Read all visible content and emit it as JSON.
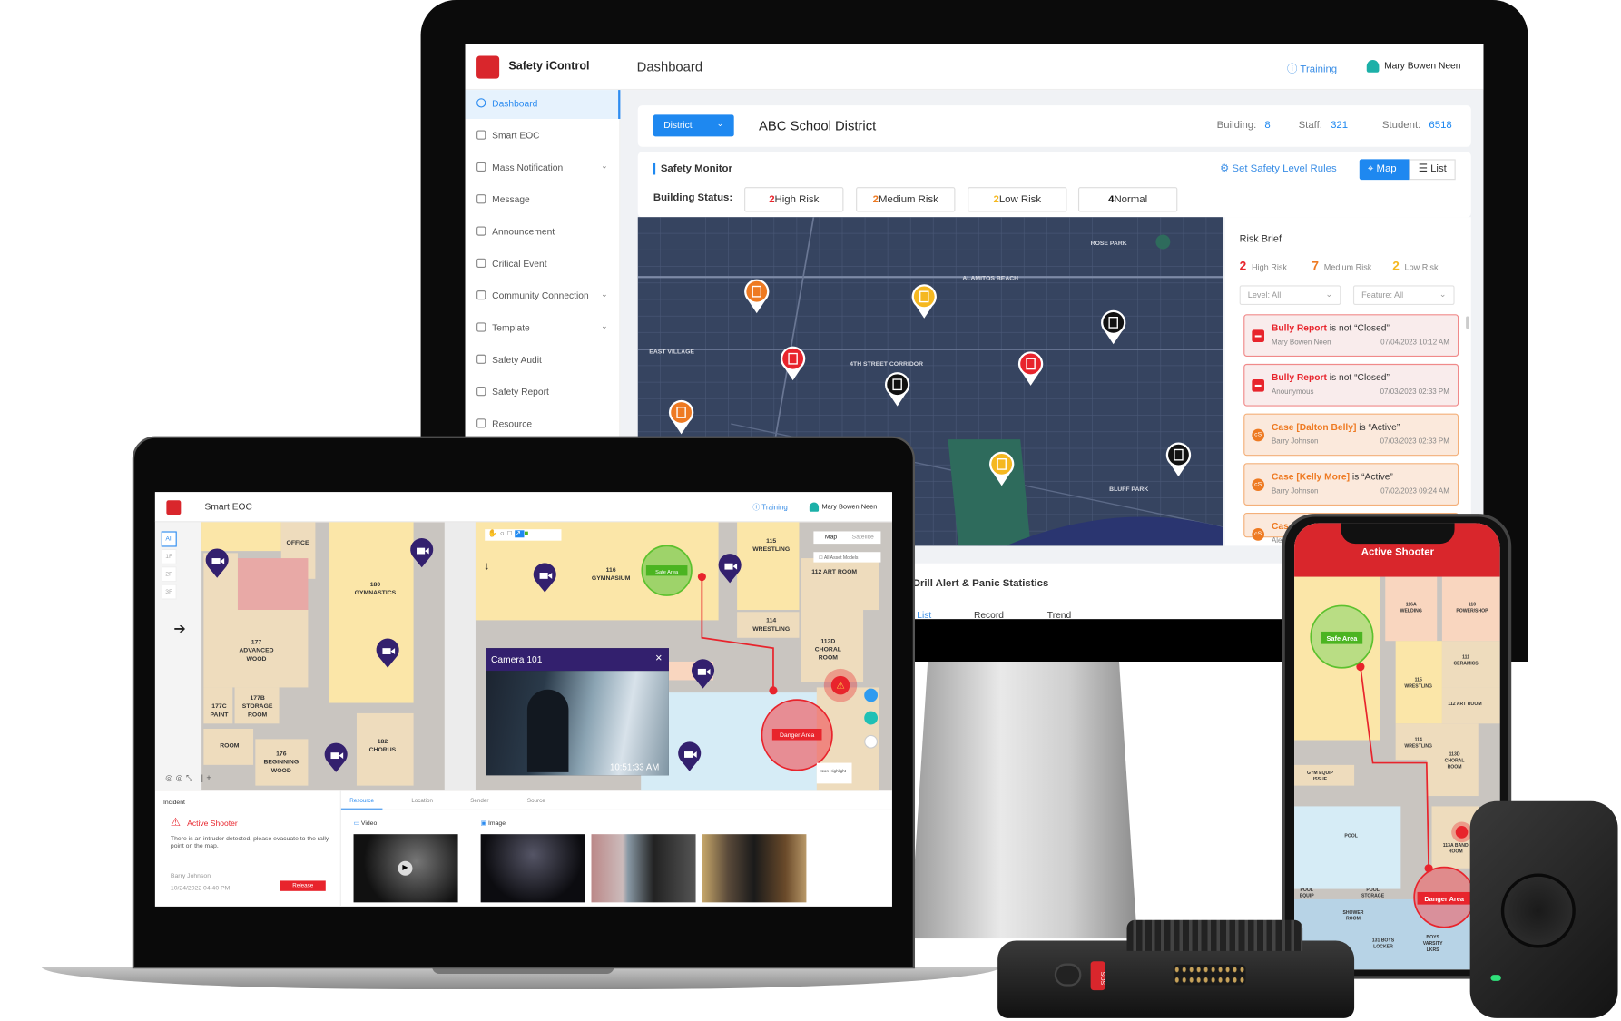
{
  "monitor": {
    "brand": "Safety iControl",
    "header_title": "Dashboard",
    "training": "Training",
    "user": "Mary Bowen Neen",
    "sidebar": [
      {
        "label": "Dashboard",
        "active": true
      },
      {
        "label": "Smart EOC"
      },
      {
        "label": "Mass Notification",
        "expandable": true
      },
      {
        "label": "Message"
      },
      {
        "label": "Announcement"
      },
      {
        "label": "Critical Event"
      },
      {
        "label": "Community Connection",
        "expandable": true
      },
      {
        "label": "Template",
        "expandable": true
      },
      {
        "label": "Safety Audit"
      },
      {
        "label": "Safety Report"
      },
      {
        "label": "Resource"
      }
    ],
    "chevron": "⌄",
    "district_select": "District",
    "district_name": "ABC School District",
    "stats": {
      "building_label": "Building:",
      "building": "8",
      "staff_label": "Staff:",
      "staff": "321",
      "student_label": "Student:",
      "student": "6518"
    },
    "safety_monitor": "Safety Monitor",
    "set_rules": "Set Safety Level Rules",
    "map_toggle": "Map",
    "list_toggle": "List",
    "building_status_label": "Building Status:",
    "status": [
      {
        "count": "2",
        "label": "High Risk",
        "color": "#e8242c"
      },
      {
        "count": "2",
        "label": "Medium Risk",
        "color": "#ee7a22"
      },
      {
        "count": "2",
        "label": "Low Risk",
        "color": "#f5b820"
      },
      {
        "count": "4",
        "label": "Normal",
        "color": "#111111"
      }
    ],
    "map": {
      "areas": [
        "ROSE PARK",
        "ALAMITOS BEACH",
        "EAST VILLAGE",
        "4TH STREET CORRIDOR",
        "BLUFF PARK"
      ],
      "pins": [
        "medium",
        "medium",
        "low",
        "low",
        "high",
        "high",
        "normal",
        "normal",
        "normal"
      ]
    },
    "risk_brief": {
      "title": "Risk Brief",
      "counts": [
        {
          "count": "2",
          "label": "High Risk",
          "color": "#e8242c"
        },
        {
          "count": "7",
          "label": "Medium Risk",
          "color": "#ee7a22"
        },
        {
          "count": "2",
          "label": "Low Risk",
          "color": "#f5b820"
        }
      ],
      "level_filter": "Level: All",
      "feature_filter": "Feature: All",
      "alerts": [
        {
          "level": "hi",
          "subject": "Bully Report",
          "status": " is not “Closed”",
          "who": "Mary Bowen Neen",
          "time": "07/04/2023 10:12 AM"
        },
        {
          "level": "hi",
          "subject": "Bully Report",
          "status": " is not “Closed”",
          "who": "Anounymous",
          "time": "07/03/2023 02:33 PM"
        },
        {
          "level": "med",
          "subject": "Case [Dalton Belly]",
          "status": " is “Active”",
          "who": "Barry Johnson",
          "time": "07/03/2023 02:33 PM"
        },
        {
          "level": "med",
          "subject": "Case [Kelly More]",
          "status": " is “Active”",
          "who": "Barry Johnson",
          "time": "07/02/2023 09:24 AM"
        },
        {
          "level": "med",
          "subject": "Cas",
          "status": "",
          "who": "Ale",
          "time": ""
        }
      ]
    },
    "drill": {
      "title": "Drill Alert & Panic Statistics",
      "tabs": [
        "List",
        "Record",
        "Trend"
      ]
    }
  },
  "laptop": {
    "app_title": "Smart EOC",
    "training": "Training",
    "user": "Mary Bowen Neen",
    "floors": [
      "All",
      "1F",
      "2F",
      "3F"
    ],
    "rooms": {
      "office": "OFFICE",
      "r177a": "177",
      "r177b": "ADVANCED",
      "r177c": "WOOD",
      "paint1": "177C",
      "paint2": "PAINT",
      "stor1": "177B",
      "stor2": "STORAGE",
      "stor3": "ROOM",
      "room": "ROOM",
      "bw1": "176",
      "bw2": "BEGINNING",
      "bw3": "WOOD",
      "gym1": "180",
      "gym2": "GYMNASTICS",
      "ch1": "182",
      "ch2": "CHORUS",
      "g116a": "116",
      "g116b": "GYMNASIUM",
      "w115a": "115",
      "w115b": "WRESTLING",
      "w114a": "114",
      "w114b": "WRESTLING",
      "art": "112 ART ROOM",
      "cr1": "113D",
      "cr2": "CHORAL",
      "cr3": "ROOM"
    },
    "safe_area": "Safe Area",
    "danger_area": "Danger Area",
    "map_tab": "Map",
    "satellite_tab": "Satellite",
    "asset_models": "All Asset Models",
    "icon_highlight": "Icon Highlight",
    "camera": {
      "title": "Camera 101",
      "close": "×",
      "time": "10:51:33 AM"
    },
    "incident": {
      "heading": "Incident",
      "type": "Active Shooter",
      "description": "There is an intruder detected, please evacuate to the rally point on the map.",
      "reporter": "Barry Johnson",
      "time": "10/24/2022 04:40 PM",
      "release": "Release"
    },
    "resource_tabs": [
      "Resource",
      "Location",
      "Sender",
      "Source"
    ],
    "video_label": "Video",
    "image_label": "Image"
  },
  "phone": {
    "title": "Active Shooter",
    "rooms": {
      "welding1": "116A",
      "welding2": "WELDING",
      "ps1": "110",
      "ps2": "POWER/SHOP",
      "w115a": "115",
      "w115b": "WRESTLING",
      "cer1": "111",
      "cer2": "CERAMICS",
      "art": "112 ART ROOM",
      "w114a": "114",
      "w114b": "WRESTLING",
      "cr1": "113D",
      "cr2": "CHORAL",
      "cr3": "ROOM",
      "gym1": "GYM EQUIP",
      "gym2": "ISSUE",
      "pool": "POOL",
      "band1": "113A BAND",
      "band2": "ROOM",
      "pe1": "POOL",
      "pe2": "EQUIP",
      "ps3": "POOL",
      "ps4": "STORAGE",
      "sh1": "SHOWER",
      "sh2": "ROOM",
      "boys1": "131 BOYS",
      "boys2": "LOCKER",
      "var1": "BOYS",
      "var2": "VARSITY",
      "var3": "LKRS"
    },
    "safe_area": "Safe Area",
    "danger_area": "Danger Area"
  },
  "radio": {
    "sos": "SOS"
  },
  "colors": {
    "accent": "#1e88f0",
    "high": "#e8242c",
    "medium": "#ee7a22",
    "low": "#f5b820",
    "normal": "#111111",
    "camera": "#33206e",
    "alert_header": "#d9262c"
  }
}
